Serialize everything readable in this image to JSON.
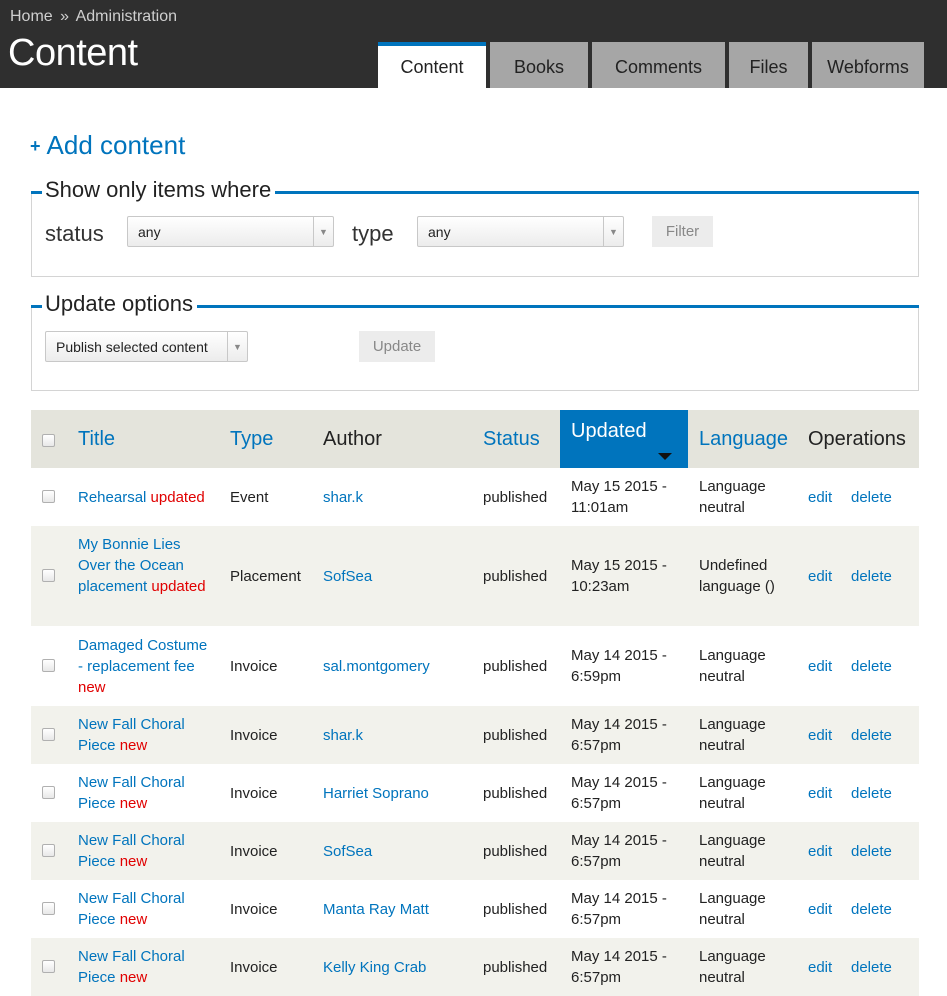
{
  "breadcrumb": {
    "home": "Home",
    "separator": "»",
    "admin": "Administration"
  },
  "page_title": "Content",
  "tabs": [
    {
      "label": "Content",
      "active": true
    },
    {
      "label": "Books",
      "active": false
    },
    {
      "label": "Comments",
      "active": false
    },
    {
      "label": "Files",
      "active": false
    },
    {
      "label": "Webforms",
      "active": false
    }
  ],
  "add_content": {
    "icon": "plus-icon",
    "label": "Add content"
  },
  "filter": {
    "legend": "Show only items where",
    "status_label": "status",
    "status_value": "any",
    "type_label": "type",
    "type_value": "any",
    "button": "Filter"
  },
  "update": {
    "legend": "Update options",
    "action_value": "Publish selected content",
    "button": "Update"
  },
  "table": {
    "headers": {
      "title": "Title",
      "type": "Type",
      "author": "Author",
      "status": "Status",
      "updated": "Updated",
      "language": "Language",
      "operations": "Operations"
    },
    "sorted_column": "Updated",
    "sort_direction": "desc",
    "rows": [
      {
        "title": "Rehearsal",
        "flag": "updated",
        "type": "Event",
        "author": "shar.k",
        "status": "published",
        "updated_date": "May 15 2015 -",
        "updated_time": "11:01am",
        "lang1": "Language",
        "lang2": "neutral",
        "edit": "edit",
        "delete": "delete"
      },
      {
        "title": "My Bonnie Lies Over the Ocean placement",
        "flag": "updated",
        "type": "Placement",
        "author": "SofSea",
        "status": "published",
        "updated_date": "May 15 2015 -",
        "updated_time": "10:23am",
        "lang1": "Undefined",
        "lang2": "language ()",
        "edit": "edit",
        "delete": "delete"
      },
      {
        "title": "Damaged Costume - replacement fee",
        "flag": "new",
        "type": "Invoice",
        "author": "sal.montgomery",
        "status": "published",
        "updated_date": "May 14 2015 -",
        "updated_time": "6:59pm",
        "lang1": "Language",
        "lang2": "neutral",
        "edit": "edit",
        "delete": "delete"
      },
      {
        "title": "New Fall Choral Piece",
        "flag": "new",
        "type": "Invoice",
        "author": "shar.k",
        "status": "published",
        "updated_date": "May 14 2015 -",
        "updated_time": "6:57pm",
        "lang1": "Language",
        "lang2": "neutral",
        "edit": "edit",
        "delete": "delete"
      },
      {
        "title": "New Fall Choral Piece",
        "flag": "new",
        "type": "Invoice",
        "author": "Harriet Soprano",
        "status": "published",
        "updated_date": "May 14 2015 -",
        "updated_time": "6:57pm",
        "lang1": "Language",
        "lang2": "neutral",
        "edit": "edit",
        "delete": "delete"
      },
      {
        "title": "New Fall Choral Piece",
        "flag": "new",
        "type": "Invoice",
        "author": "SofSea",
        "status": "published",
        "updated_date": "May 14 2015 -",
        "updated_time": "6:57pm",
        "lang1": "Language",
        "lang2": "neutral",
        "edit": "edit",
        "delete": "delete"
      },
      {
        "title": "New Fall Choral Piece",
        "flag": "new",
        "type": "Invoice",
        "author": "Manta Ray Matt",
        "status": "published",
        "updated_date": "May 14 2015 -",
        "updated_time": "6:57pm",
        "lang1": "Language",
        "lang2": "neutral",
        "edit": "edit",
        "delete": "delete"
      },
      {
        "title": "New Fall Choral Piece",
        "flag": "new",
        "type": "Invoice",
        "author": "Kelly King Crab",
        "status": "published",
        "updated_date": "May 14 2015 -",
        "updated_time": "6:57pm",
        "lang1": "Language",
        "lang2": "neutral",
        "edit": "edit",
        "delete": "delete"
      }
    ]
  },
  "colors": {
    "accent": "#0074bd",
    "header_bg": "#2f2f2f",
    "flag": "#e00000"
  }
}
